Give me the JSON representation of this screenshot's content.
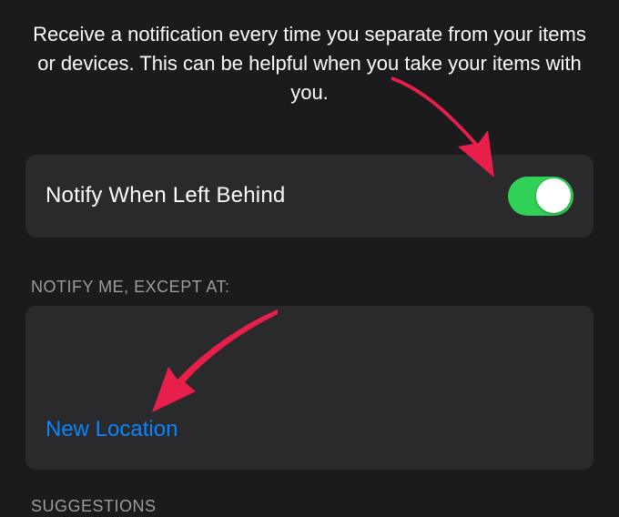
{
  "description": "Receive a notification every time you separate from your items or devices. This can be helpful when you take your items with you.",
  "notify_cell": {
    "label": "Notify When Left Behind",
    "toggle_on": true
  },
  "exceptions": {
    "header": "NOTIFY ME, EXCEPT AT:",
    "new_location_label": "New Location"
  },
  "suggestions_header": "SUGGESTIONS",
  "annotation_arrows": [
    {
      "target": "notify-toggle"
    },
    {
      "target": "new-location-button"
    }
  ]
}
